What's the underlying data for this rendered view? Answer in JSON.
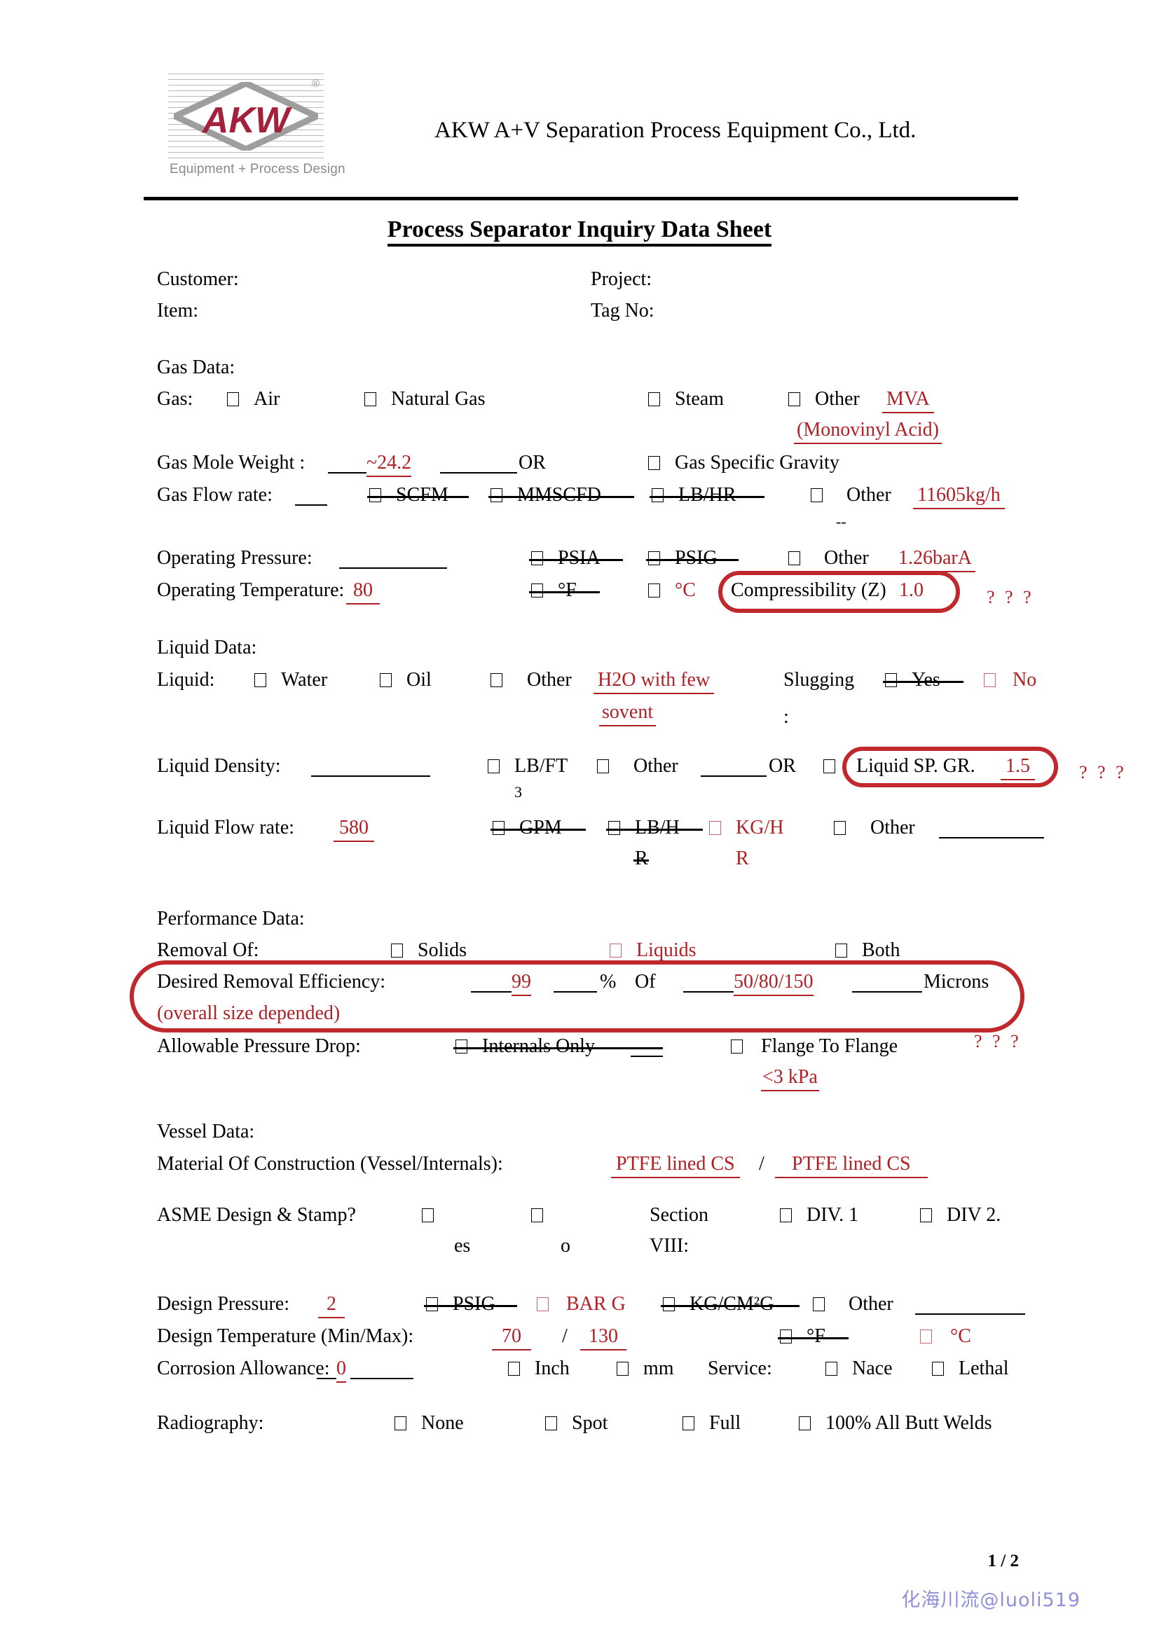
{
  "header": {
    "company_name": "AKW A+V Separation Process Equipment Co., Ltd.",
    "logo_text": "AKW",
    "logo_tagline": "Equipment + Process Design",
    "logo_registered": "®"
  },
  "title": "Process Separator Inquiry Data Sheet",
  "identity": {
    "customer_label": "Customer:",
    "customer_value": "",
    "item_label": "Item:",
    "item_value": "",
    "project_label": "Project:",
    "project_value": "",
    "tag_no_label": "Tag No:",
    "tag_no_value": ""
  },
  "gas_data": {
    "section_label": "Gas Data:",
    "gas_label": "Gas:",
    "options": [
      "Air",
      "Natural Gas",
      "Steam",
      "Other"
    ],
    "gas_other_value": "MVA",
    "gas_other_value_line2": "(Monovinyl Acid)",
    "mole_weight_label": "Gas Mole Weight :",
    "mole_weight_value": "~24.2",
    "or_label": "OR",
    "specific_gravity_label": "Gas Specific Gravity",
    "flow_rate_label": "Gas Flow rate:",
    "flow_rate_value": "",
    "flow_units": [
      "SCFM",
      "MMSCFD",
      "LB/HR",
      "Other"
    ],
    "flow_other_value": "11605kg/h",
    "flow_other_mark": "--",
    "op_pressure_label": "Operating Pressure:",
    "op_pressure_value": "",
    "op_pressure_units": [
      "PSIA",
      "PSIG",
      "Other"
    ],
    "op_pressure_other_value": "1.26barA",
    "op_temp_label": "Operating Temperature:",
    "op_temp_value": "80",
    "op_temp_units": [
      "°F",
      "°C"
    ],
    "compressibility_label": "Compressibility (Z)",
    "compressibility_value": "1.0",
    "query_mark": "? ? ?"
  },
  "liquid_data": {
    "section_label": "Liquid Data:",
    "liquid_label": "Liquid:",
    "options": [
      "Water",
      "Oil",
      "Other"
    ],
    "liquid_other_value": "H2O with few",
    "liquid_other_value_line2": "sovent",
    "slugging_label": "Slugging",
    "slugging_colon": ":",
    "slugging_yes": "Yes",
    "slugging_no": "No",
    "density_label": "Liquid Density:",
    "density_value": "",
    "density_unit_1": "LB/FT",
    "density_unit_1_sup": "3",
    "density_unit_other": "Other",
    "density_or": "OR",
    "sp_gr_label": "Liquid SP. GR.",
    "sp_gr_value": "1.5",
    "sp_gr_query": "? ? ?",
    "flow_rate_label": "Liquid Flow rate:",
    "flow_rate_value": "580",
    "flow_unit_gpm": "GPM",
    "flow_unit_lbhr_1": "LB/H",
    "flow_unit_lbhr_2": "R",
    "flow_unit_kghr_1": "KG/H",
    "flow_unit_kghr_2": "R",
    "flow_unit_other": "Other"
  },
  "performance_data": {
    "section_label": "Performance Data:",
    "removal_of_label": "Removal Of:",
    "removal_options": [
      "Solids",
      "Liquids",
      "Both"
    ],
    "efficiency_label": "Desired  Removal  Efficiency:",
    "efficiency_value": "99",
    "efficiency_pct": "%",
    "efficiency_of": "Of",
    "microns_value": "50/80/150",
    "microns_label": "Microns",
    "efficiency_note": "(overall size depended)",
    "pressure_drop_label": "Allowable Pressure Drop:",
    "pressure_drop_internals": "Internals Only",
    "pressure_drop_flange": "Flange To Flange",
    "pressure_drop_value": "<3 kPa",
    "query_mark": "? ? ?"
  },
  "vessel_data": {
    "section_label": "Vessel Data:",
    "material_label": "Material Of Construction (Vessel/Internals):",
    "material_vessel": "PTFE lined CS",
    "material_slash": "/",
    "material_internals": "PTFE lined CS",
    "asme_label": "ASME Design & Stamp?",
    "asme_yes_wrap": "es",
    "asme_no_wrap": "o",
    "section_viii_1": "Section",
    "section_viii_2": "VIII:",
    "div1": "DIV. 1",
    "div2": "DIV 2.",
    "design_pressure_label": "Design Pressure:",
    "design_pressure_value": "2",
    "design_pressure_units": [
      "PSIG",
      "BAR G",
      "KG/CM²G",
      "Other"
    ],
    "design_pressure_other_value": "",
    "design_temp_label": "Design Temperature (Min/Max):",
    "design_temp_min": "70",
    "design_temp_sep": "/",
    "design_temp_max": "130",
    "design_temp_units": [
      "°F",
      "°C"
    ],
    "corrosion_label": "Corrosion Allowance:",
    "corrosion_value": "0",
    "corrosion_units": [
      "Inch",
      "mm"
    ],
    "service_label": "Service:",
    "service_options": [
      "Nace",
      "Lethal"
    ],
    "radiography_label": "Radiography:",
    "radiography_options": [
      "None",
      "Spot",
      "Full",
      "100% All Butt Welds"
    ]
  },
  "footer": {
    "page_number": "1 / 2",
    "watermark": "化海川流@luoli519"
  },
  "colors": {
    "annotation_red": "#b01f24",
    "oval_red": "#c0282d",
    "watermark": "#8f90d8"
  }
}
